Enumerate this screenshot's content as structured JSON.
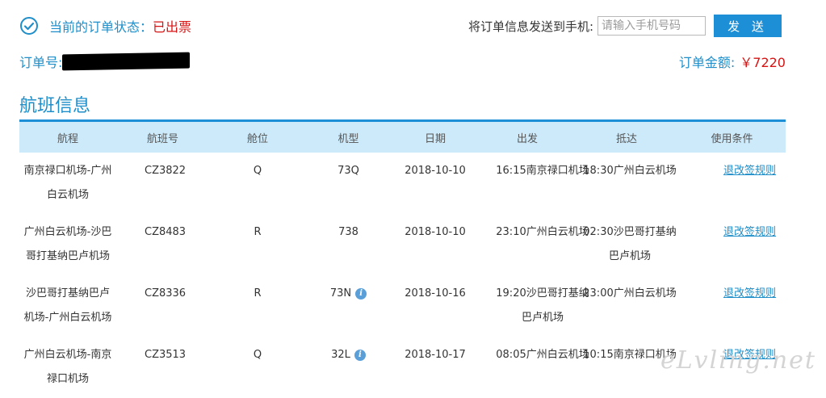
{
  "order": {
    "status_label": "当前的订单状态：",
    "status_value": "已出票",
    "send_label": "将订单信息发送到手机:",
    "phone_placeholder": "请输入手机号码",
    "send_button": "发 送",
    "order_no_label": "订单号:",
    "amount_label": "订单金额:",
    "amount_value": "￥7220",
    "status_color": "#d51414",
    "accent_color": "#1f8ec9",
    "button_color": "#1d8fd6"
  },
  "section": {
    "title": "航班信息"
  },
  "table": {
    "headers": {
      "route": "航程",
      "flight": "航班号",
      "cabin": "舱位",
      "type": "机型",
      "date": "日期",
      "departure": "出发",
      "arrival": "抵达",
      "conditions": "使用条件"
    },
    "rows": [
      {
        "route": "南京禄口机场-广州白云机场",
        "flight": "CZ3822",
        "cabin": "Q",
        "type": "73Q",
        "info_icon": false,
        "date": "2018-10-10",
        "departure": "16:15南京禄口机场",
        "arrival": "18:30广州白云机场",
        "rule": "退改签规则"
      },
      {
        "route": "广州白云机场-沙巴哥打基纳巴卢机场",
        "flight": "CZ8483",
        "cabin": "R",
        "type": "738",
        "info_icon": false,
        "date": "2018-10-10",
        "departure": "23:10广州白云机场",
        "arrival": "02:30沙巴哥打基纳巴卢机场",
        "rule": "退改签规则"
      },
      {
        "route": "沙巴哥打基纳巴卢机场-广州白云机场",
        "flight": "CZ8336",
        "cabin": "R",
        "type": "73N",
        "info_icon": true,
        "date": "2018-10-16",
        "departure": "19:20沙巴哥打基纳巴卢机场",
        "arrival": "23:00广州白云机场",
        "rule": "退改签规则"
      },
      {
        "route": "广州白云机场-南京禄口机场",
        "flight": "CZ3513",
        "cabin": "Q",
        "type": "32L",
        "info_icon": true,
        "date": "2018-10-17",
        "departure": "08:05广州白云机场",
        "arrival": "10:15南京禄口机场",
        "rule": "退改签规则"
      }
    ]
  },
  "icons": {
    "status": "check-circle-icon",
    "info": "info-icon",
    "info_glyph": "i"
  },
  "watermark": {
    "text": "eLvling.net"
  }
}
